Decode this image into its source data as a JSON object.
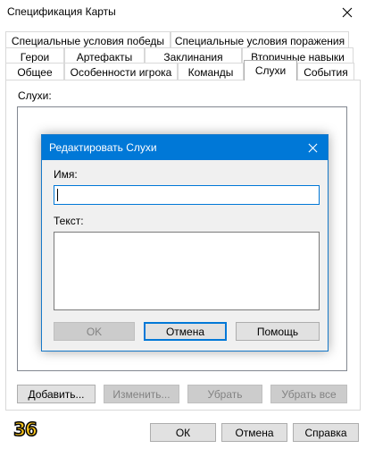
{
  "window": {
    "title": "Спецификация Карты",
    "close_glyph": "✕"
  },
  "tabs": {
    "row1": [
      "Специальные условия победы",
      "Специальные условия поражения"
    ],
    "row2": [
      "Герои",
      "Артефакты",
      "Заклинания",
      "Вторичные навыки"
    ],
    "row3": [
      "Общее",
      "Особенности игрока",
      "Команды",
      "Слухи",
      "События"
    ],
    "selected": "Слухи"
  },
  "rumors_page": {
    "list_label": "Слухи:",
    "buttons": {
      "add": "Добавить...",
      "edit": "Изменить...",
      "remove": "Убрать",
      "remove_all": "Убрать все"
    }
  },
  "footer": {
    "ok": "ОК",
    "cancel": "Отмена",
    "help": "Справка",
    "badge": "36",
    "badge_color": "#f6c21a"
  },
  "dialog": {
    "title": "Редактировать Слухи",
    "name_label": "Имя:",
    "name_value": "",
    "text_label": "Текст:",
    "text_value": "",
    "ok": "OK",
    "cancel": "Отмена",
    "help": "Помощь",
    "accent_color": "#0078d7"
  }
}
